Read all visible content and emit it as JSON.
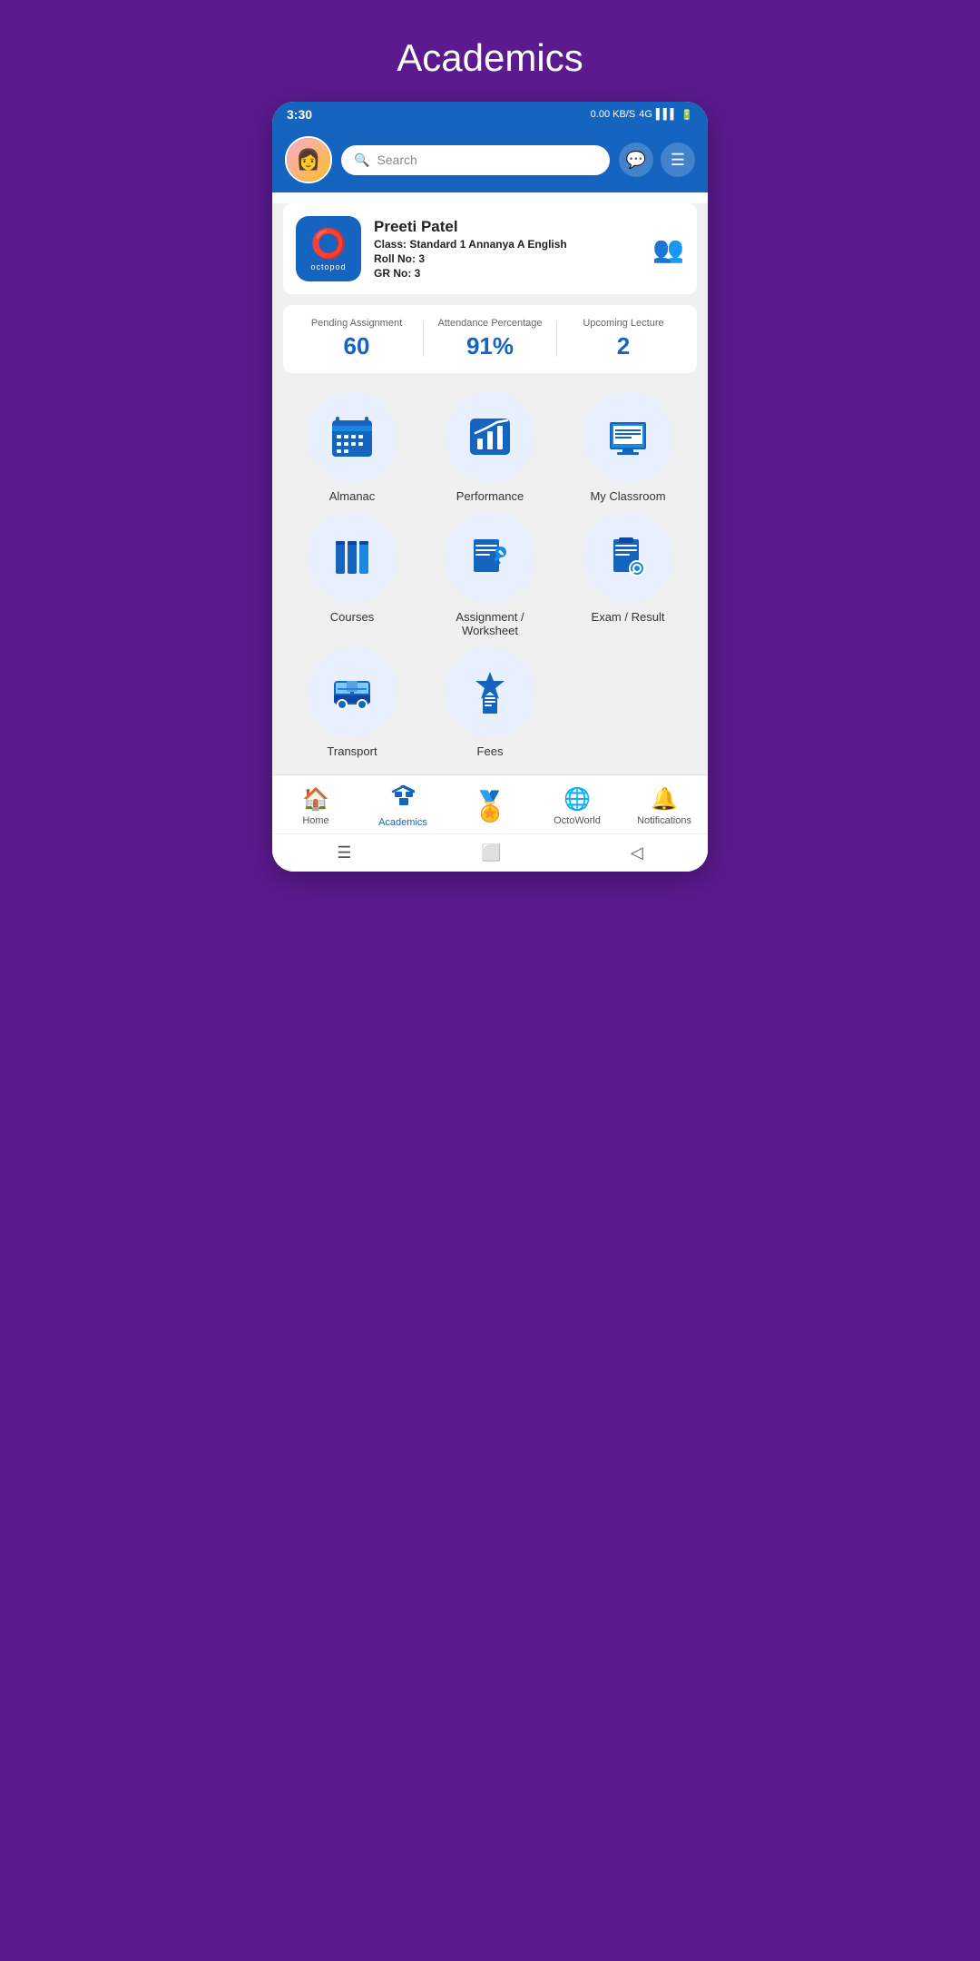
{
  "page": {
    "title": "Academics"
  },
  "statusBar": {
    "time": "3:30",
    "network": "0.00 KB/S",
    "carrier": "4G"
  },
  "header": {
    "searchPlaceholder": "Search",
    "searchIcon": "🔍"
  },
  "profile": {
    "name": "Preeti Patel",
    "classLabel": "Class:",
    "classValue": "Standard 1 Annanya A English",
    "rollLabel": "Roll No:",
    "rollValue": "3",
    "grLabel": "GR No:",
    "grValue": "3"
  },
  "stats": [
    {
      "label": "Pending Assignment",
      "value": "60"
    },
    {
      "label": "Attendance Percentage",
      "value": "91%"
    },
    {
      "label": "Upcoming Lecture",
      "value": "2"
    }
  ],
  "gridItems": [
    {
      "label": "Almanac",
      "icon": "📅"
    },
    {
      "label": "Performance",
      "icon": "📊"
    },
    {
      "label": "My Classroom",
      "icon": "📚"
    },
    {
      "label": "Courses",
      "icon": "📖"
    },
    {
      "label": "Assignment /\nWorksheet",
      "icon": "📝"
    },
    {
      "label": "Exam / Result",
      "icon": "📋"
    },
    {
      "label": "Transport",
      "icon": "🚌"
    },
    {
      "label": "Fees",
      "icon": "🎓"
    }
  ],
  "bottomNav": [
    {
      "label": "Home",
      "icon": "🏠",
      "active": false
    },
    {
      "label": "Academics",
      "icon": "✏️",
      "active": true
    },
    {
      "label": "",
      "icon": "🏅",
      "active": false,
      "center": true
    },
    {
      "label": "OctoWorld",
      "icon": "🌐",
      "active": false
    },
    {
      "label": "Notifications",
      "icon": "🔔",
      "active": false
    }
  ]
}
